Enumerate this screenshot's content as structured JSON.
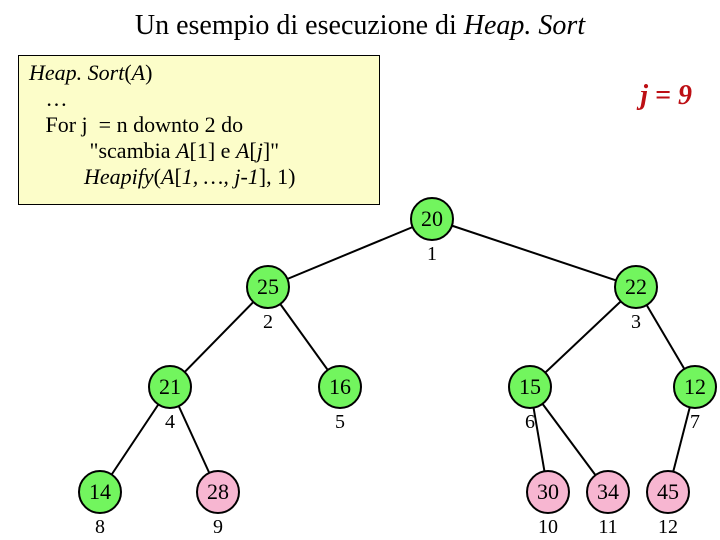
{
  "title": {
    "prefix": "Un esempio di esecuzione di ",
    "italic": "Heap. Sort"
  },
  "j_label": "j = 9",
  "code": {
    "l1a": "Heap. Sort",
    "l1b": "(",
    "l1c": "A",
    "l1d": ")",
    "l2": "   …",
    "l3": "   For j  = n downto 2 do",
    "l4a": "           \"scambia ",
    "l4b": "A",
    "l4c": "[1] e ",
    "l4d": "A",
    "l4e": "[",
    "l4f": "j",
    "l4g": "]\"",
    "l5a": "          ",
    "l5b": "Heapify",
    "l5c": "(",
    "l5d": "A",
    "l5e": "[",
    "l5f": "1, …, j-1",
    "l5g": "], 1)"
  },
  "chart_data": {
    "type": "tree",
    "title": "Heap.Sort execution j=9",
    "nodes": [
      {
        "index": 1,
        "value": 20,
        "color": "green"
      },
      {
        "index": 2,
        "value": 25,
        "color": "green"
      },
      {
        "index": 3,
        "value": 22,
        "color": "green"
      },
      {
        "index": 4,
        "value": 21,
        "color": "green"
      },
      {
        "index": 5,
        "value": 16,
        "color": "green"
      },
      {
        "index": 6,
        "value": 15,
        "color": "green"
      },
      {
        "index": 7,
        "value": 12,
        "color": "green"
      },
      {
        "index": 8,
        "value": 14,
        "color": "green"
      },
      {
        "index": 9,
        "value": 28,
        "color": "pink"
      },
      {
        "index": 10,
        "value": 30,
        "color": "pink"
      },
      {
        "index": 11,
        "value": 34,
        "color": "pink"
      },
      {
        "index": 12,
        "value": 45,
        "color": "pink"
      }
    ],
    "edges": [
      [
        1,
        2
      ],
      [
        1,
        3
      ],
      [
        2,
        4
      ],
      [
        2,
        5
      ],
      [
        3,
        6
      ],
      [
        3,
        7
      ],
      [
        4,
        8
      ],
      [
        4,
        9
      ],
      [
        6,
        10
      ],
      [
        6,
        11
      ],
      [
        7,
        12
      ]
    ]
  },
  "nodes": {
    "n1": {
      "val": "20",
      "idx": "1"
    },
    "n2": {
      "val": "25",
      "idx": "2"
    },
    "n3": {
      "val": "22",
      "idx": "3"
    },
    "n4": {
      "val": "21",
      "idx": "4"
    },
    "n5": {
      "val": "16",
      "idx": "5"
    },
    "n6": {
      "val": "15",
      "idx": "6"
    },
    "n7": {
      "val": "12",
      "idx": "7"
    },
    "n8": {
      "val": "14",
      "idx": "8"
    },
    "n9": {
      "val": "28",
      "idx": "9"
    },
    "n10": {
      "val": "30",
      "idx": "10"
    },
    "n11": {
      "val": "34",
      "idx": "11"
    },
    "n12": {
      "val": "45",
      "idx": "12"
    }
  }
}
